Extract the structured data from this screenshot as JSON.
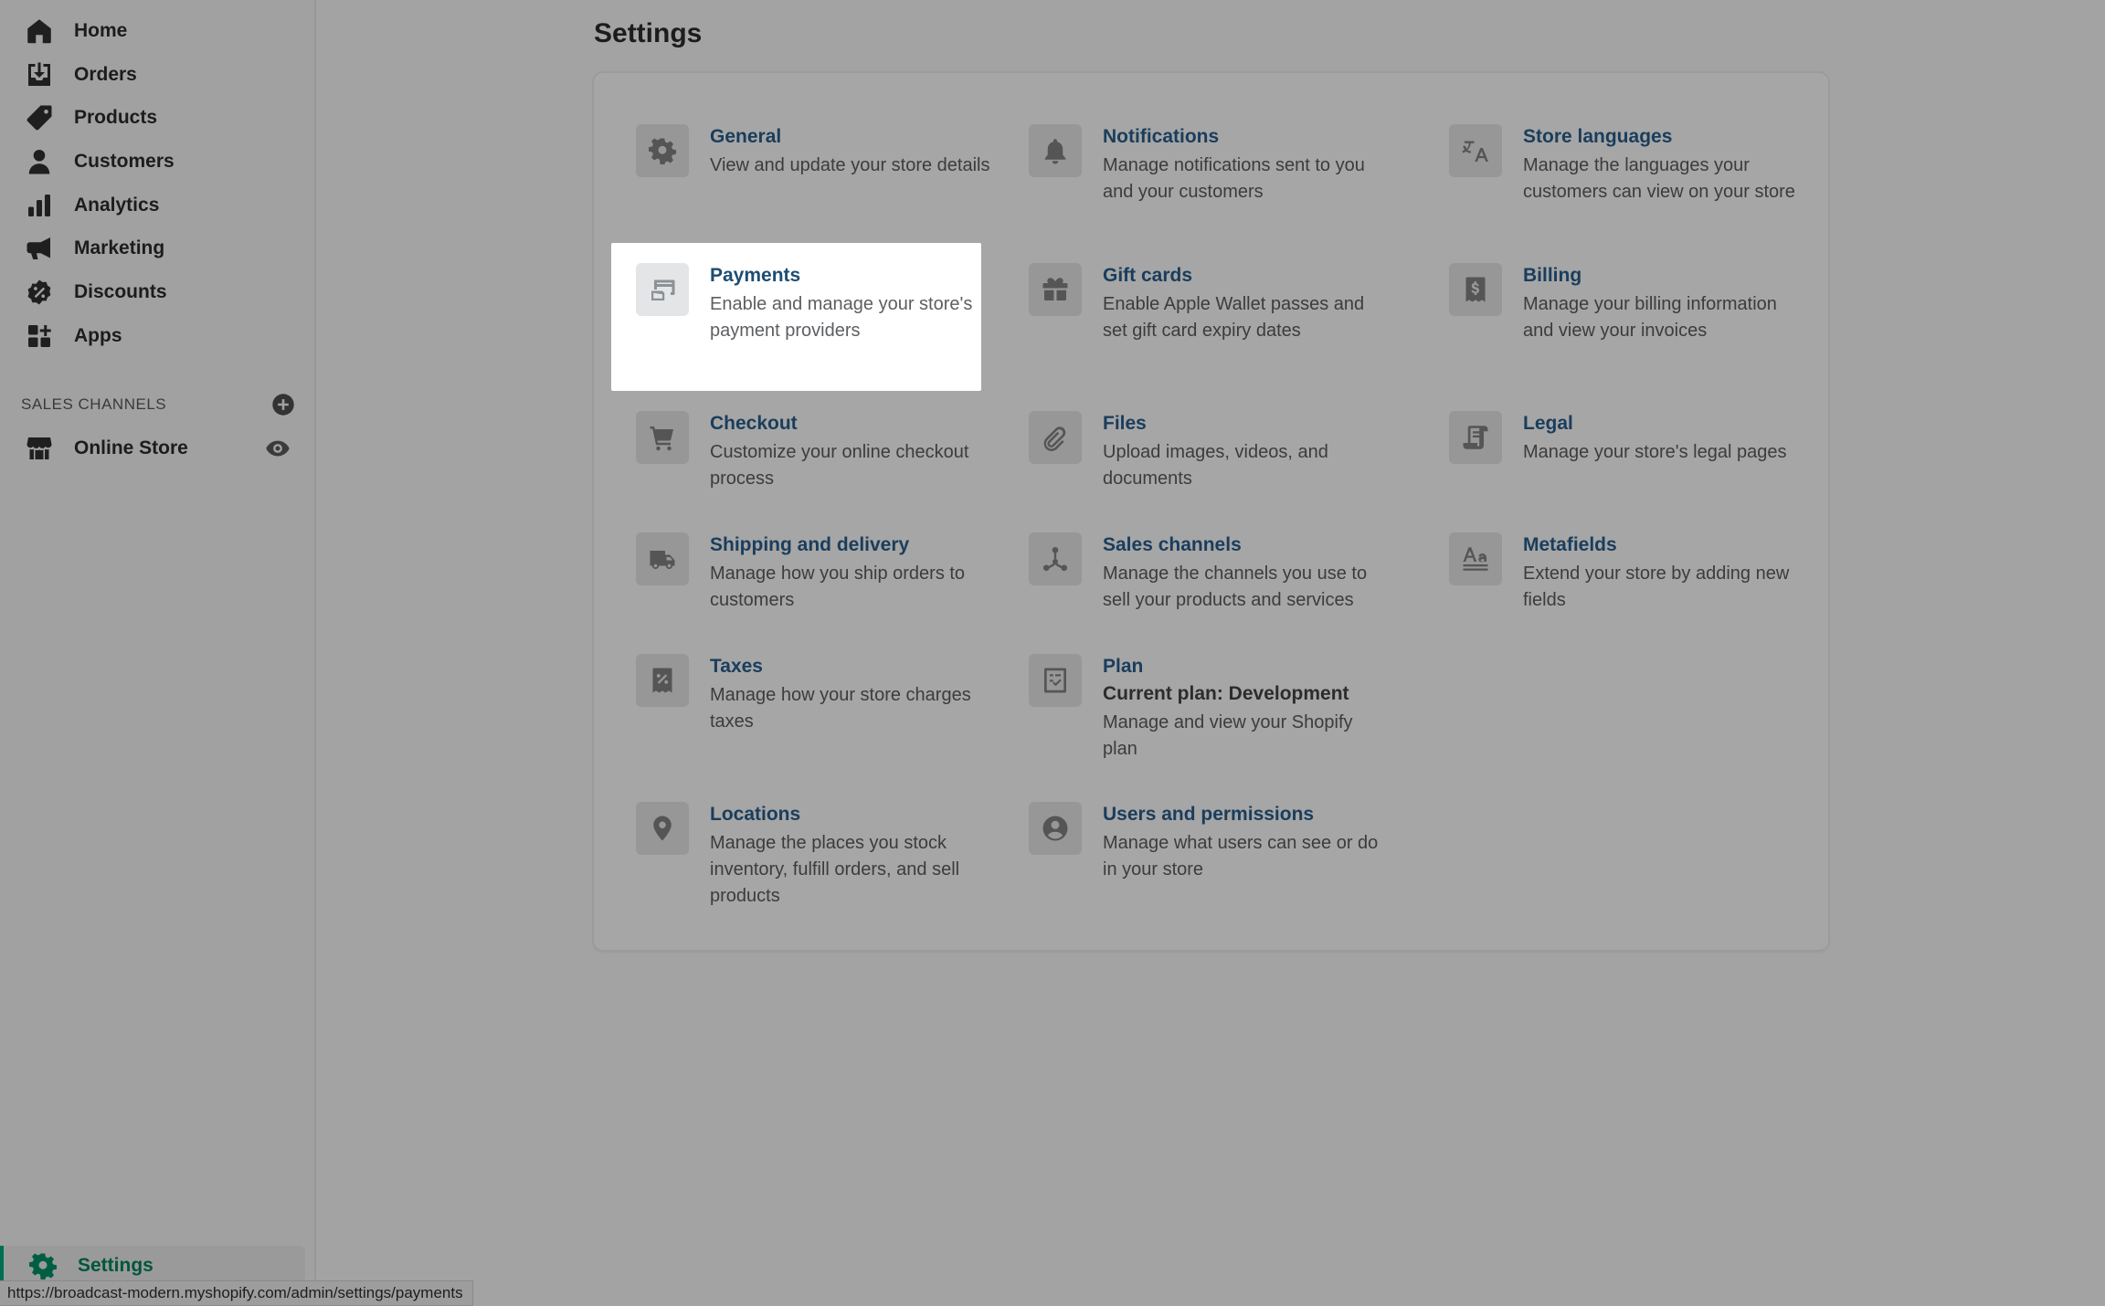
{
  "sidebar": {
    "items": [
      {
        "label": "Home",
        "icon": "home-icon"
      },
      {
        "label": "Orders",
        "icon": "orders-icon"
      },
      {
        "label": "Products",
        "icon": "tag-icon"
      },
      {
        "label": "Customers",
        "icon": "person-icon"
      },
      {
        "label": "Analytics",
        "icon": "bar-chart-icon"
      },
      {
        "label": "Marketing",
        "icon": "megaphone-icon"
      },
      {
        "label": "Discounts",
        "icon": "discount-icon"
      },
      {
        "label": "Apps",
        "icon": "apps-icon"
      }
    ],
    "sales_channels_header": "SALES CHANNELS",
    "online_store": "Online Store",
    "settings": "Settings"
  },
  "status_bar": {
    "url": "https://broadcast-modern.myshopify.com/admin/settings/payments"
  },
  "main": {
    "title": "Settings",
    "tiles": [
      {
        "title": "General",
        "desc": "View and update your store details",
        "icon": "gear-icon"
      },
      {
        "title": "Notifications",
        "desc": "Manage notifications sent to you and your customers",
        "icon": "bell-icon"
      },
      {
        "title": "Store languages",
        "desc": "Manage the languages your customers can view on your store",
        "icon": "translate-icon"
      },
      {
        "title": "Payments",
        "desc": "Enable and manage your store's payment providers",
        "icon": "payment-icon"
      },
      {
        "title": "Gift cards",
        "desc": "Enable Apple Wallet passes and set gift card expiry dates",
        "icon": "gift-icon"
      },
      {
        "title": "Billing",
        "desc": "Manage your billing information and view your invoices",
        "icon": "billing-icon"
      },
      {
        "title": "Checkout",
        "desc": "Customize your online checkout process",
        "icon": "cart-icon"
      },
      {
        "title": "Files",
        "desc": "Upload images, videos, and documents",
        "icon": "paperclip-icon"
      },
      {
        "title": "Legal",
        "desc": "Manage your store's legal pages",
        "icon": "legal-icon"
      },
      {
        "title": "Shipping and delivery",
        "desc": "Manage how you ship orders to customers",
        "icon": "truck-icon"
      },
      {
        "title": "Sales channels",
        "desc": "Manage the channels you use to sell your products and services",
        "icon": "channels-icon"
      },
      {
        "title": "Metafields",
        "desc": "Extend your store by adding new fields",
        "icon": "metafields-icon"
      },
      {
        "title": "Taxes",
        "desc": "Manage how your store charges taxes",
        "icon": "tax-icon"
      },
      {
        "title": "Plan",
        "subtitle": "Current plan: Development",
        "desc": "Manage and view your Shopify plan",
        "icon": "plan-icon"
      },
      {
        "title": "Locations",
        "desc": "Manage the places you stock inventory, fulfill orders, and sell products",
        "icon": "location-icon"
      },
      {
        "title": "Users and permissions",
        "desc": "Manage what users can see or do in your store",
        "icon": "user-circle-icon"
      }
    ]
  }
}
